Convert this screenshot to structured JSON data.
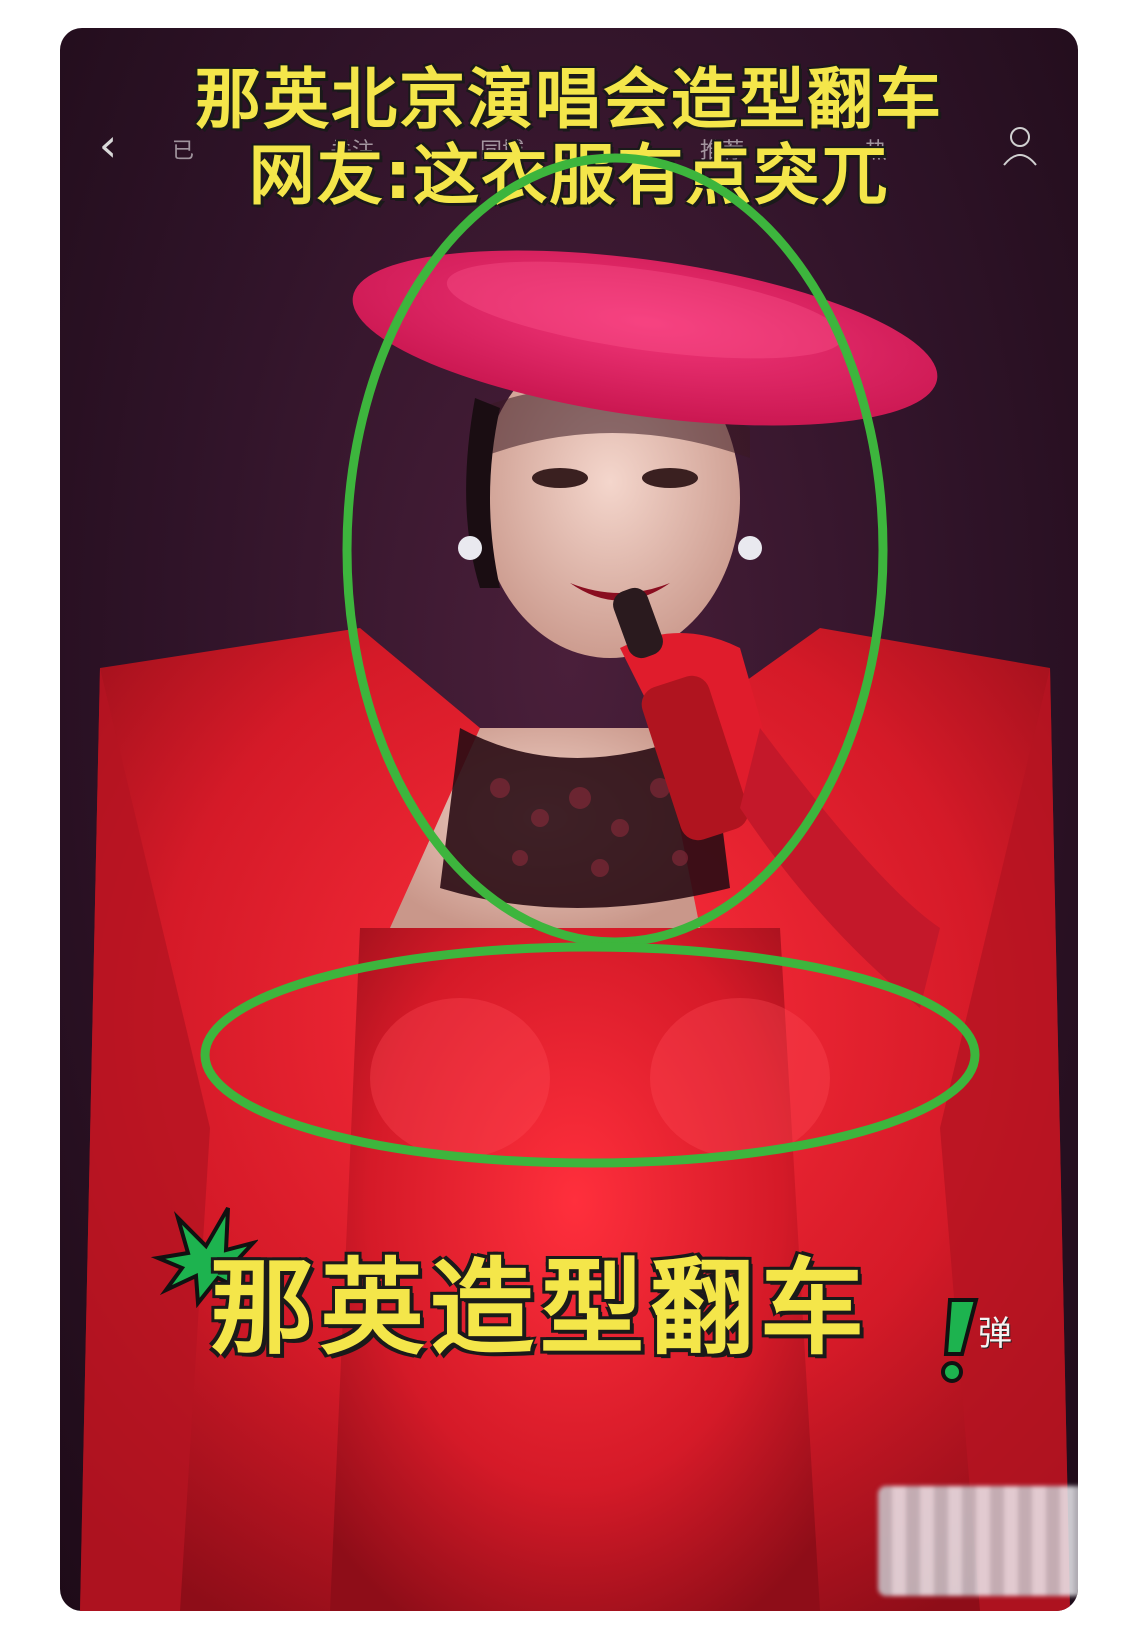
{
  "video": {
    "headline_line1": "那英北京演唱会造型翻车",
    "headline_line2": "网友:这衣服有点突兀",
    "caption": "那英造型翻车",
    "caption_tag": "弹"
  },
  "nav": {
    "back_icon": "chevron-left-icon",
    "tabs": [
      "已",
      "关注",
      "同城",
      "推荐",
      "热"
    ],
    "profile_icon": "person-icon"
  },
  "annotations": {
    "circle_color": "#3db53d",
    "count": 2
  },
  "colors": {
    "headline_text": "#f4e64a",
    "outfit_red": "#d81b2c",
    "hat_pink": "#e0205a",
    "background": "#2f1328"
  }
}
